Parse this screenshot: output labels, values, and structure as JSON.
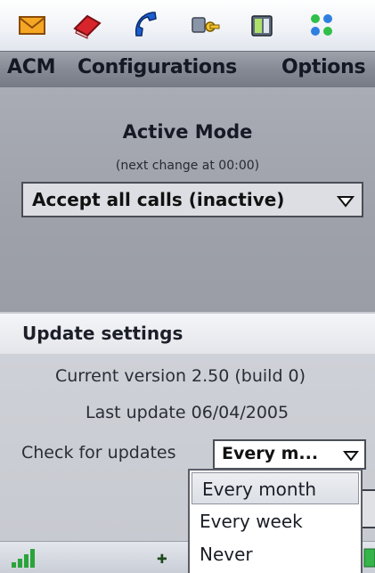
{
  "toolbar": {
    "icons": [
      "envelope-icon",
      "book-icon",
      "phone-icon",
      "key-icon",
      "card-icon",
      "grid-icon"
    ]
  },
  "menu": {
    "items": [
      {
        "label": "ACM"
      },
      {
        "label": "Configurations"
      },
      {
        "label": "Options"
      }
    ]
  },
  "active_mode": {
    "title": "Active Mode",
    "subtitle": "(next change at 00:00)",
    "selected": "Accept all calls (inactive)"
  },
  "update_settings": {
    "header": "Update settings",
    "current_version": "Current version 2.50 (build 0)",
    "last_update": "Last update 06/04/2005",
    "check_label": "Check for updates",
    "check_selected": "Every m...",
    "options": [
      "Every month",
      "Every week",
      "Never"
    ]
  },
  "colors": {
    "menubar": "#868a94",
    "panel": "#9ea1aa",
    "settings_bg": "#ced1d7",
    "signal": "#2aa43a"
  }
}
